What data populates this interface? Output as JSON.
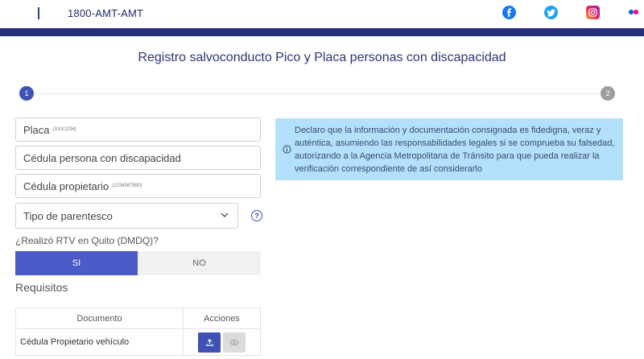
{
  "header": {
    "phone": "1800-AMT-AMT",
    "social_icons": [
      "facebook-icon",
      "twitter-icon",
      "instagram-icon",
      "flickr-icon"
    ]
  },
  "page": {
    "title": "Registro salvoconducto Pico y Placa personas con discapacidad"
  },
  "stepper": {
    "steps": [
      "1",
      "2"
    ],
    "active_color": "#3f51b5",
    "inactive_color": "#9e9e9e"
  },
  "form": {
    "placa": {
      "label": "Placa",
      "hint": "(XXX1234)"
    },
    "cedula_discapacidad": {
      "label": "Cédula persona con discapacidad"
    },
    "cedula_propietario": {
      "label": "Cédula propietario",
      "hint": "(1234567890)"
    },
    "parentesco": {
      "selected": "Tipo de parentesco"
    },
    "rtv_question": "¿Realizó RTV en Quito (DMDQ)?",
    "rtv_yes": "SI",
    "rtv_no": "NO",
    "accent": "#4b5bc8"
  },
  "requirements": {
    "title": "Requisitos",
    "columns": [
      "Documento",
      "Acciones"
    ],
    "rows": [
      {
        "documento": "Cédula Propietario vehículo"
      }
    ]
  },
  "info": {
    "text": "Declaro que la información y documentación consignada es fidedigna, veraz y auténtica, asumiendo las responsabilidades legales si se comprueba su falsedad, autorizando a la Agencia Metropolitana de Tránsito para que pueda realizar la verificación correspondiente de así considerarlo",
    "background": "#b3e1fb"
  }
}
